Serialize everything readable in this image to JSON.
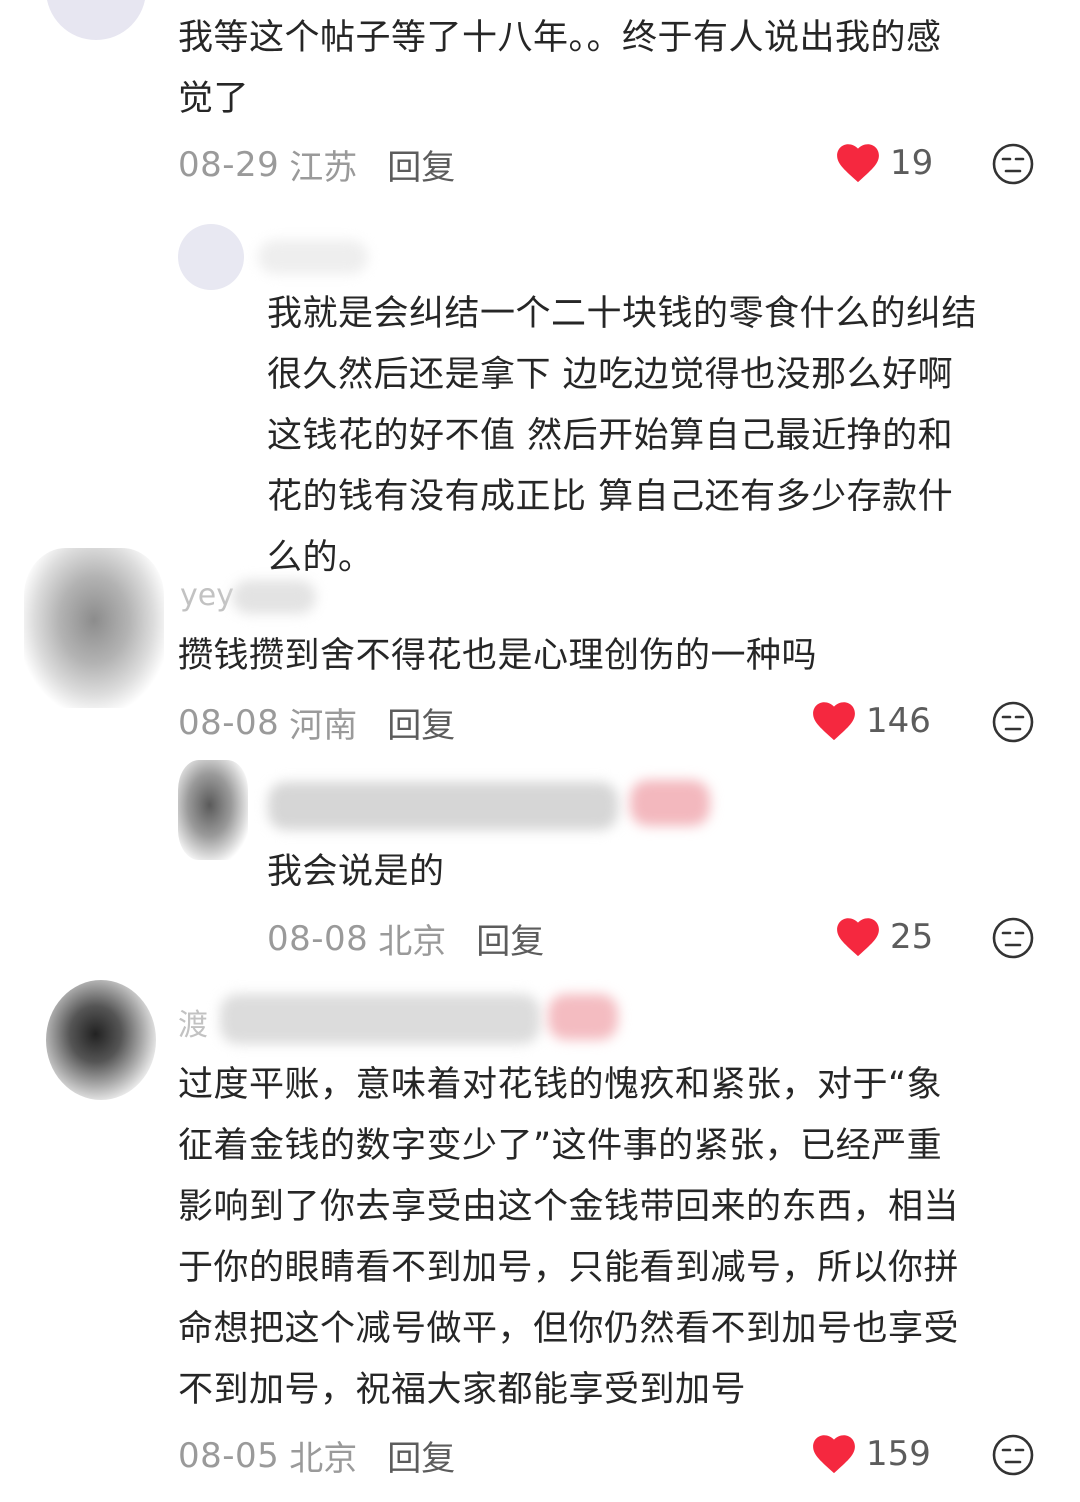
{
  "colors": {
    "heart": "#f5283f",
    "meta_gray": "#9a9a9a",
    "reply_gray": "#5c5c5c",
    "text": "#262626"
  },
  "comments": [
    {
      "text_lines": [
        "我等这个帖子等了十八年。。终于有人说出我的感",
        "觉了"
      ],
      "date": "08-29",
      "location": "江苏",
      "reply_label": "回复",
      "likes": "19"
    },
    {
      "text_lines": [
        "我就是会纠结一个二十块钱的零食什么的纠结",
        "很久然后还是拿下 边吃边觉得也没那么好啊",
        "这钱花的好不值 然后开始算自己最近挣的和",
        "花的钱有没有成正比 算自己还有多少存款什",
        "么的。"
      ]
    },
    {
      "username": "yey",
      "text_lines": [
        "攒钱攒到舍不得花也是心理创伤的一种吗"
      ],
      "date": "08-08",
      "location": "河南",
      "reply_label": "回复",
      "likes": "146"
    },
    {
      "text_lines": [
        "我会说是的"
      ],
      "date": "08-08",
      "location": "北京",
      "reply_label": "回复",
      "likes": "25"
    },
    {
      "username": "渡",
      "text_lines": [
        "过度平账，意味着对花钱的愧疚和紧张，对于“象",
        "征着金钱的数字变少了”这件事的紧张，已经严重",
        "影响到了你去享受由这个金钱带回来的东西，相当",
        "于你的眼睛看不到加号，只能看到减号，所以你拼",
        "命想把这个减号做平，但你仍然看不到加号也享受",
        "不到加号，祝福大家都能享受到加号"
      ],
      "date": "08-05",
      "location": "北京",
      "reply_label": "回复",
      "likes": "159"
    }
  ]
}
